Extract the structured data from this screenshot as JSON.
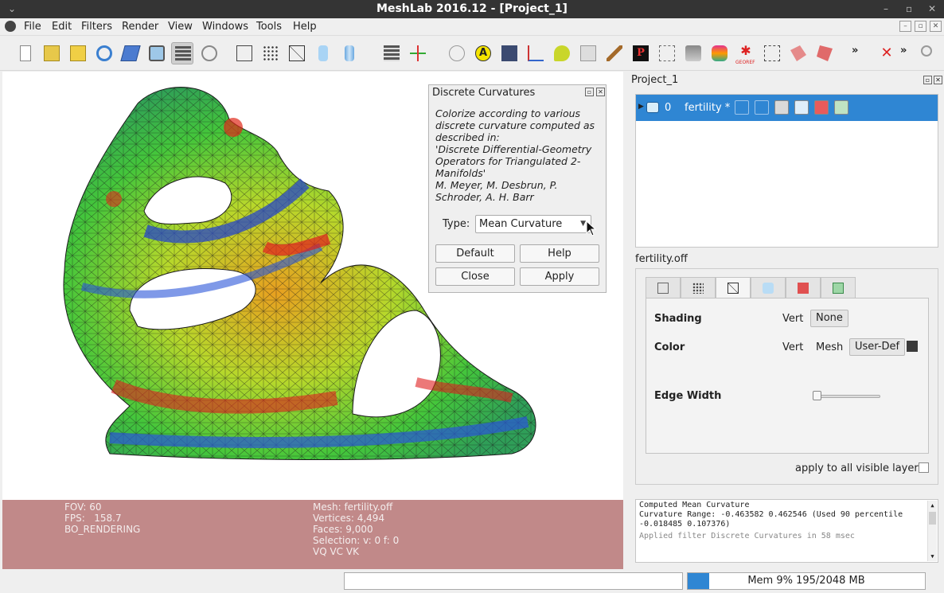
{
  "window": {
    "title": "MeshLab 2016.12 - [Project_1]"
  },
  "menu": {
    "items": [
      "File",
      "Edit",
      "Filters",
      "Render",
      "View",
      "Windows",
      "Tools",
      "Help"
    ]
  },
  "toolbar": {
    "icons": [
      "new-icon",
      "open-project-icon",
      "open-icon",
      "reload-icon",
      "save-icon",
      "snapshot-icon",
      "layers-icon",
      "projection-icon",
      "bbox-icon",
      "points-icon",
      "wireframe-icon",
      "flat-icon",
      "smooth-icon",
      "textures-icon",
      "axis-icon",
      "sphere-icon",
      "annotation-icon",
      "align-icon",
      "measure-icon",
      "paint-icon",
      "pick-points-icon",
      "mutual-info-icon",
      "select-vertices-icon",
      "select-faces-icon",
      "georef-icon",
      "select-connected-icon",
      "select-region-icon",
      "z-painting-icon",
      "overflow-icon",
      "disable-icon",
      "zoom-icon"
    ],
    "annotation_glyph": "A",
    "georef_label": "GEOREF",
    "overflow_label": "»"
  },
  "viewport": {
    "fov_label": "FOV: 60",
    "fps_label": "FPS:",
    "fps_value": "158.7",
    "render_mode": "BO_RENDERING",
    "mesh": "Mesh: fertility.off",
    "vertices": "Vertices: 4,494",
    "faces": "Faces: 9,000",
    "selection": "Selection: v: 0 f: 0",
    "flags": "VQ VC VK",
    "status_bg": "#c18989"
  },
  "dialog": {
    "title": "Discrete Curvatures",
    "description": [
      "Colorize according to various",
      "discrete curvature computed as",
      "described in:",
      "'Discrete Differential-Geometry",
      "Operators for Triangulated 2-",
      "Manifolds'",
      "M. Meyer, M. Desbrun, P.",
      "Schroder, A. H. Barr"
    ],
    "type_label": "Type:",
    "type_value": "Mean Curvature",
    "buttons": {
      "default": "Default",
      "help": "Help",
      "close": "Close",
      "apply": "Apply"
    }
  },
  "project_panel": {
    "title": "Project_1",
    "layer": {
      "index": "0",
      "name": "fertility *"
    },
    "accent": "#2f86d3"
  },
  "properties": {
    "mesh_label": "fertility.off",
    "shading_label": "Shading",
    "shading_vert": "Vert",
    "shading_none": "None",
    "color_label": "Color",
    "color_vert": "Vert",
    "color_mesh": "Mesh",
    "color_userdef": "User-Def",
    "edge_width_label": "Edge Width",
    "edge_width_value": 0,
    "apply_all_label": "apply to all visible layers",
    "apply_all_checked": false
  },
  "log": {
    "lines": [
      "Computed Mean Curvature",
      "Curvature Range: -0.463582 0.462546 (Used 90 percentile",
      "-0.018485 0.107376)"
    ],
    "applied": "Applied filter Discrete Curvatures in 58 msec"
  },
  "statusbar": {
    "mem_label": "Mem 9% 195/2048 MB",
    "mem_percent": 9
  }
}
